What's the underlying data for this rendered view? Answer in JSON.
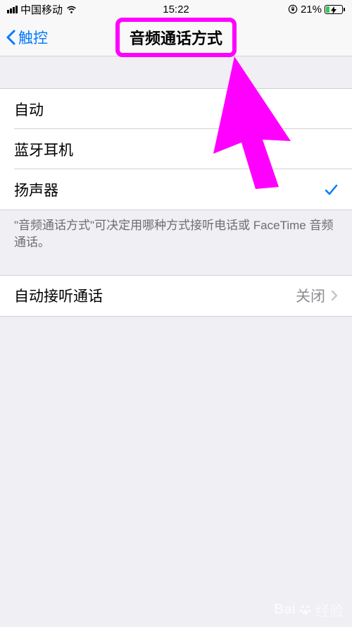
{
  "status": {
    "carrier": "中国移动",
    "time": "15:22",
    "battery_pct": "21%"
  },
  "nav": {
    "back_label": "触控",
    "title": "音频通话方式"
  },
  "options": [
    {
      "label": "自动",
      "selected": false
    },
    {
      "label": "蓝牙耳机",
      "selected": false
    },
    {
      "label": "扬声器",
      "selected": true
    }
  ],
  "footer": "\"音频通话方式\"可决定用哪种方式接听电话或 FaceTime 音频通话。",
  "auto_answer": {
    "label": "自动接听通话",
    "value": "关闭"
  },
  "watermark": {
    "brand": "Bai",
    "brand2": "经验"
  }
}
